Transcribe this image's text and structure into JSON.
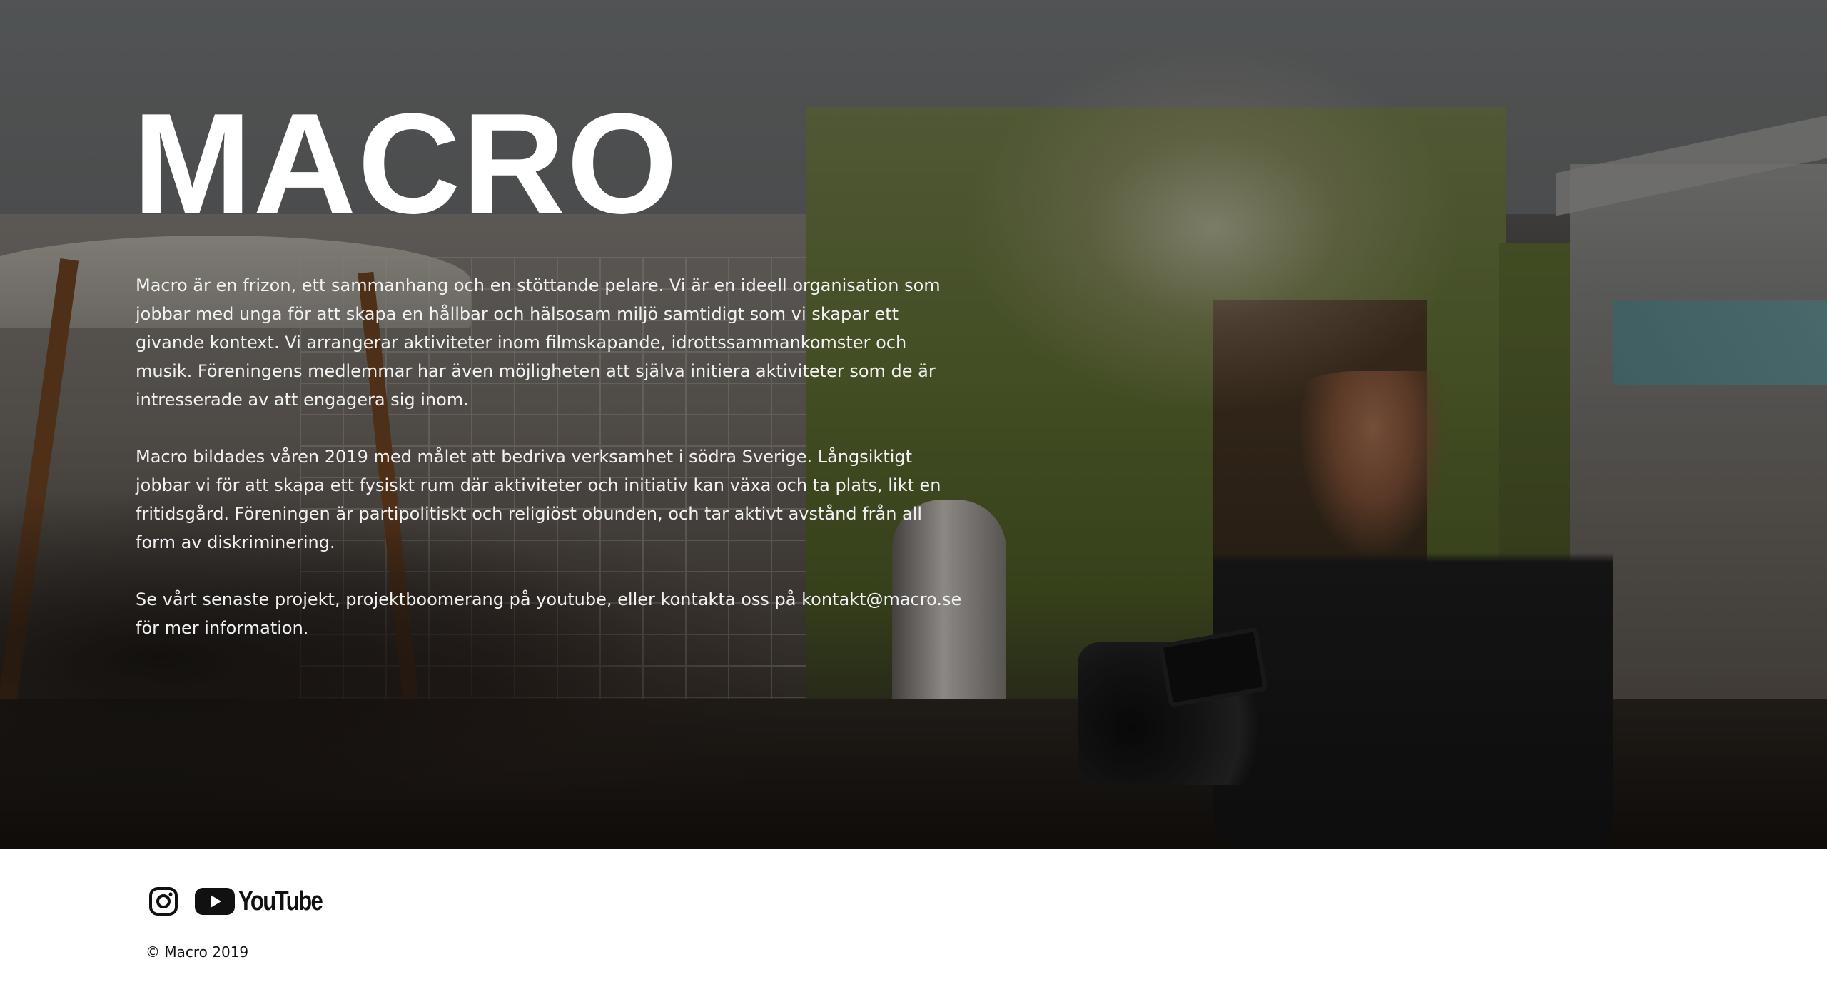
{
  "hero": {
    "title": "MACRO",
    "paragraphs": [
      "Macro är en frizon, ett sammanhang och en stöttande pelare. Vi är en ideell organisation som jobbar med unga för att skapa en hållbar och hälsosam miljö samtidigt som vi skapar ett givande kontext. Vi arrangerar aktiviteter inom filmskapande, idrottssammankomster och musik. Föreningens medlemmar har även möjligheten att själva initiera aktiviteter som de är intresserade av att engagera sig inom.",
      "Macro bildades våren 2019 med målet att bedriva verksamhet i södra Sverige. Långsiktigt jobbar vi för att skapa ett fysiskt rum där aktiviteter och initiativ kan växa och ta plats, likt en fritidsgård. Föreningen är partipolitiskt och religiöst obunden, och tar aktivt avstånd från all form av diskriminering.",
      "Se vårt senaste projekt, projektboomerang på youtube, eller kontakta oss på kontakt@macro.se för mer information."
    ]
  },
  "footer": {
    "social": {
      "instagram_icon": "instagram-icon",
      "youtube_icon": "youtube-icon",
      "youtube_word": "YouTube"
    },
    "copyright": "© Macro 2019"
  },
  "colors": {
    "text_light": "#ffffff",
    "footer_bg": "#ffffff",
    "footer_text": "#111111"
  }
}
